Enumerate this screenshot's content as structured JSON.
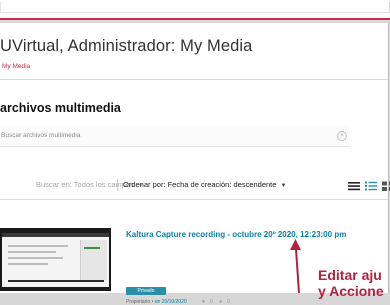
{
  "header": {
    "title": "UVirtual, Administrador: My Media",
    "breadcrumb": "My Media"
  },
  "section": {
    "title": "archivos multimedia"
  },
  "search": {
    "placeholder": "Buscar archivos multimedia",
    "clear_icon": "x-circle-icon"
  },
  "filters": {
    "search_in_label": "Buscar en: Todos los campos",
    "sort_label": "Ordenar por: Fecha de creación: descendente",
    "view_icons": [
      "list-view-icon",
      "detailed-view-icon",
      "grid-view-icon"
    ]
  },
  "entries": [
    {
      "title": "Kaltura Capture recording - octubre 20º 2020, 12:23:00 pm",
      "badge": "Privado",
      "owner_role": "Propietario",
      "date": "en 20/10/2020",
      "likes": "0",
      "comments": "0"
    }
  ],
  "annotation": {
    "line1": "Editar aju",
    "line2": "y Accione",
    "color": "#b3223c"
  },
  "colors": {
    "accent": "#c0304a",
    "link": "#0a82a7",
    "badge": "#2b8fa8"
  }
}
